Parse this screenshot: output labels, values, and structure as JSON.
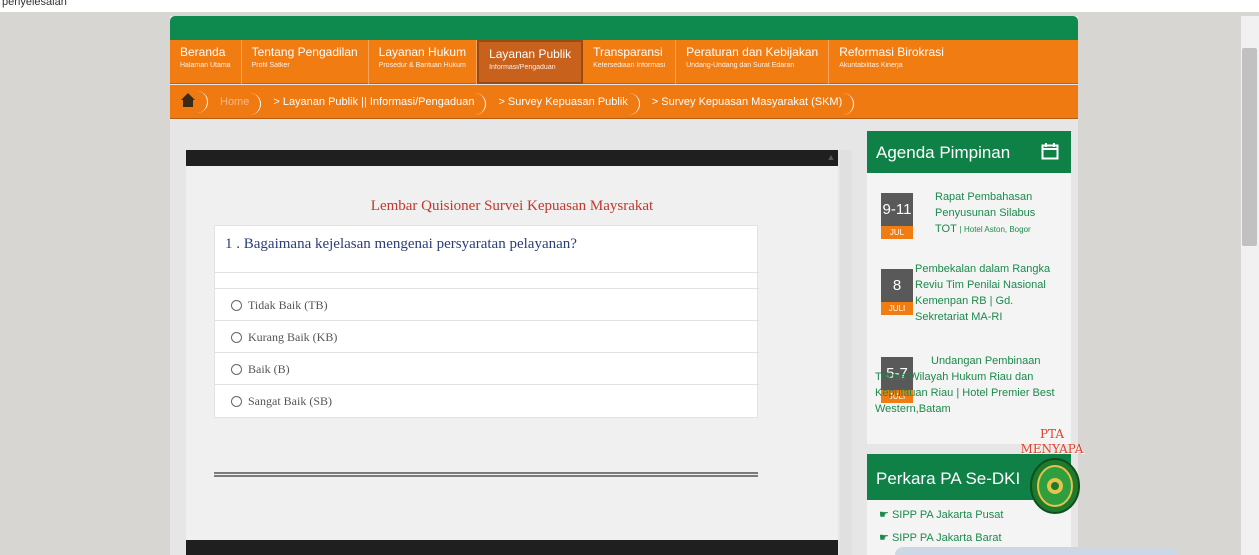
{
  "top_strip": {
    "text": "penyelesaian"
  },
  "menu": [
    {
      "title": "Beranda",
      "sub": "Halaman Utama"
    },
    {
      "title": "Tentang Pengadilan",
      "sub": "Profil Satker"
    },
    {
      "title": "Layanan Hukum",
      "sub": "Prosedur & Bantuan Hukum"
    },
    {
      "title": "Layanan Publik",
      "sub": "Informasi/Pengaduan",
      "active": true
    },
    {
      "title": "Transparansi",
      "sub": "Ketersediaan Informasi"
    },
    {
      "title": "Peraturan dan Kebijakan",
      "sub": "Undang-Undang dan Surat Edaran"
    },
    {
      "title": "Reformasi Birokrasi",
      "sub": "Akuntabilitas Kinerja"
    }
  ],
  "breadcrumb": {
    "home": "Home",
    "items": [
      "> Layanan Publik || Informasi/Pengaduan",
      "> Survey Kepuasan Publik",
      "> Survey Kepuasan Masyarakat (SKM)"
    ]
  },
  "questionnaire": {
    "title": "Lembar Quisioner Survei Kepuasan Maysrakat",
    "question": "1 . Bagaimana kejelasan mengenai persyaratan pelayanan?",
    "options": [
      "Tidak Baik (TB)",
      "Kurang Baik (KB)",
      "Baik (B)",
      "Sangat Baik (SB)"
    ]
  },
  "agenda": {
    "title": "Agenda Pimpinan",
    "items": [
      {
        "day": "9-11",
        "month": "JUL",
        "text": "Rapat Pembahasan Penyusunan Silabus TOT",
        "location": "| Hotel Aston, Bogor"
      },
      {
        "day": "8",
        "month": "JULI",
        "text": "Pembekalan dalam Rangka Reviu Tim Penilai Nasional Kemenpan RB | Gd. Sekretariat MA-RI"
      },
      {
        "day": "5-7",
        "month": "JULI",
        "text": "Undangan Pembinaan Teknis Wilayah Hukum Riau dan Kepulauan Riau | Hotel Premier Best Western,Batam"
      }
    ]
  },
  "pta_badge": {
    "line1": "PTA",
    "line2": "MENYAPA"
  },
  "perkara": {
    "title": "Perkara PA Se-DKI",
    "links": [
      "SIPP PA Jakarta Pusat",
      "SIPP PA Jakarta Barat"
    ]
  },
  "colors": {
    "green": "#0f8147",
    "orange": "#f07c12",
    "active_menu": "#c8611b",
    "title_red": "#c0392b"
  }
}
